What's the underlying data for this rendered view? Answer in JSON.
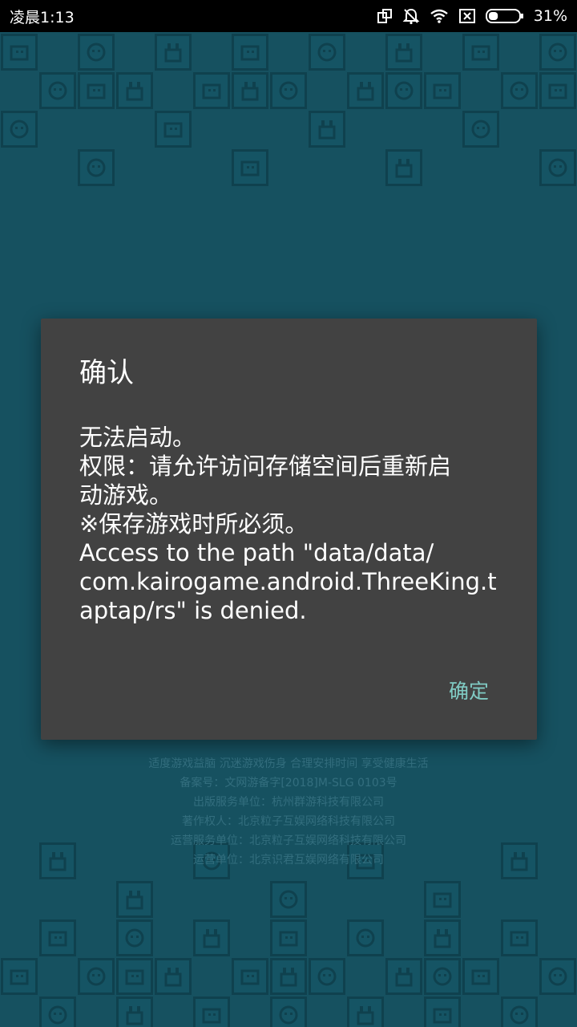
{
  "status_bar": {
    "time": "凌晨1:13",
    "battery_percent": "31%",
    "battery_level": 0.31,
    "icons": [
      "screen-rotate-icon",
      "notifications-off-icon",
      "wifi-icon",
      "sim-absent-icon",
      "battery-icon"
    ]
  },
  "background": {
    "legal_lines": [
      "适度游戏益脑 沉迷游戏伤身 合理安排时间 享受健康生活",
      "备案号：文网游备字[2018]M-SLG 0103号",
      "出版服务单位：杭州群游科技有限公司",
      "著作权人：北京粒子互娱网络科技有限公司",
      "运营服务单位：北京粒子互娱网络科技有限公司",
      "运营单位：北京识君互娱网络有限公司"
    ]
  },
  "dialog": {
    "title": "确认",
    "message_lines": [
      "无法启动。",
      "权限：请允许访问存储空间后重新启",
      "动游戏。",
      "※保存游戏时所必须。",
      "Access to the path \"data/data/",
      "com.kairogame.android.ThreeKing.t",
      "aptap/rs\" is denied."
    ],
    "ok_label": "确定"
  },
  "colors": {
    "status_bar_bg": "#000000",
    "game_bg": "#1b5e70",
    "dialog_bg": "#424242",
    "accent": "#80cbc4"
  }
}
